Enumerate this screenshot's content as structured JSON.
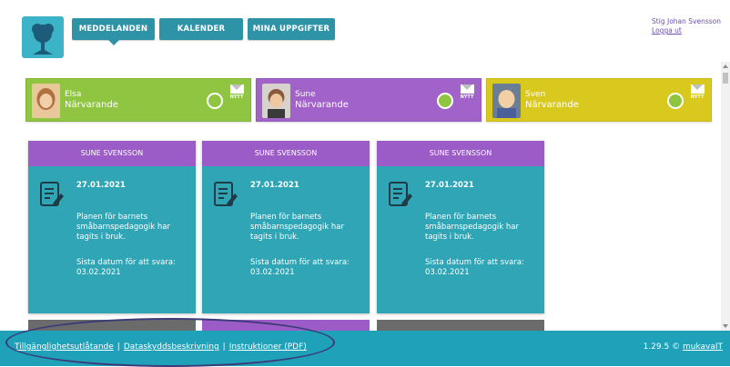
{
  "nav": {
    "tabs": [
      "MEDDELANDEN",
      "KALENDER",
      "MINA UPPGIFTER"
    ],
    "active": "MEDDELANDEN"
  },
  "user": {
    "name": "Stig Johan Svensson",
    "logout": "Logga ut"
  },
  "children": [
    {
      "name": "Elsa",
      "status": "Närvarande",
      "badge": "NYTT",
      "color": "#8fc540"
    },
    {
      "name": "Sune",
      "status": "Närvarande",
      "badge": "NYTT",
      "color": "#a163c9"
    },
    {
      "name": "Sven",
      "status": "Närvarande",
      "badge": "NYTT",
      "color": "#d9c91f"
    }
  ],
  "messages": [
    {
      "child": "SUNE SVENSSON",
      "date": "27.01.2021",
      "text": "Planen för barnets småbarnspedagogik har tagits i bruk.",
      "deadline": "Sista datum för att svara: 03.02.2021"
    },
    {
      "child": "SUNE SVENSSON",
      "date": "27.01.2021",
      "text": "Planen för barnets småbarnspedagogik har tagits i bruk.",
      "deadline": "Sista datum för att svara: 03.02.2021"
    },
    {
      "child": "SUNE SVENSSON",
      "date": "27.01.2021",
      "text": "Planen för barnets småbarnspedagogik har tagits i bruk.",
      "deadline": "Sista datum för att svara: 03.02.2021"
    }
  ],
  "footer": {
    "links": [
      "Tillgänglighetsutlåtande",
      "Dataskyddsbeskrivning",
      "Instruktioner (PDF)"
    ],
    "separator": "|",
    "version": "1.29.5 ©",
    "brand": "mukavaIT"
  },
  "colors": {
    "teal": "#2fa5b6",
    "purple": "#9b5cc8",
    "footer": "#1ea1b9",
    "link_purple": "#6c4db3"
  }
}
